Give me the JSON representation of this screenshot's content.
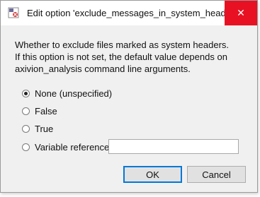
{
  "window": {
    "title": "Edit option 'exclude_messages_in_system_headers'",
    "close_glyph": "✕"
  },
  "description": {
    "line1": "Whether to exclude files marked as system headers.",
    "line2": "If this option is not set, the default value depends on",
    "line3": "axivion_analysis command line arguments."
  },
  "options": [
    {
      "label": "None (unspecified)",
      "selected": true
    },
    {
      "label": "False",
      "selected": false
    },
    {
      "label": "True",
      "selected": false
    },
    {
      "label": "Variable reference",
      "selected": false
    }
  ],
  "variable_input": {
    "value": "",
    "placeholder": ""
  },
  "buttons": {
    "ok": "OK",
    "cancel": "Cancel"
  },
  "icons": {
    "app": "app-icon",
    "close": "close-icon",
    "radio": "radio-icon"
  },
  "colors": {
    "close_bg": "#e81123",
    "accent": "#0078d7",
    "window_bg": "#f0f0f0"
  }
}
